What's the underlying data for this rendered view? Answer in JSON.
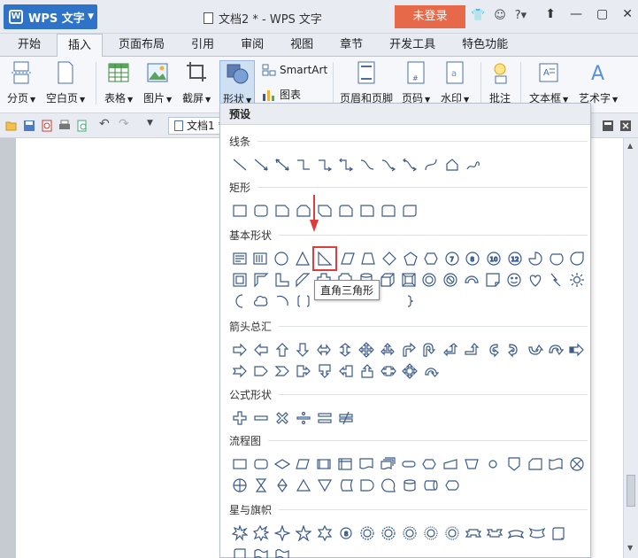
{
  "app": {
    "name": "WPS 文字",
    "doc_title": "文档2 * - WPS 文字",
    "login": "未登录"
  },
  "tabs": [
    "开始",
    "插入",
    "页面布局",
    "引用",
    "审阅",
    "视图",
    "章节",
    "开发工具",
    "特色功能"
  ],
  "active_tab": "插入",
  "ribbon": {
    "page_break": "分页",
    "blank_page": "空白页",
    "table": "表格",
    "picture": "图片",
    "screenshot": "截屏",
    "shapes": "形状",
    "smartart": "SmartArt",
    "chart": "图表",
    "header_footer": "页眉和页脚",
    "page_number": "页码",
    "watermark": "水印",
    "comment": "批注",
    "textbox": "文本框",
    "wordart": "艺术字"
  },
  "quick_access": {
    "doc_tab": "文档1"
  },
  "panel": {
    "header": "预设",
    "sections": {
      "lines": "线条",
      "rect": "矩形",
      "basic": "基本形状",
      "arrows": "箭头总汇",
      "formula": "公式形状",
      "flowchart": "流程图",
      "stars": "星与旗帜"
    },
    "basic_numbers": [
      "7",
      "8",
      "10",
      "12"
    ],
    "tooltip": "直角三角形"
  },
  "colors": {
    "accent": "#2e73c8",
    "login": "#e66a49",
    "highlight": "#e23b3b",
    "shape_stroke": "#3b5b8a"
  }
}
